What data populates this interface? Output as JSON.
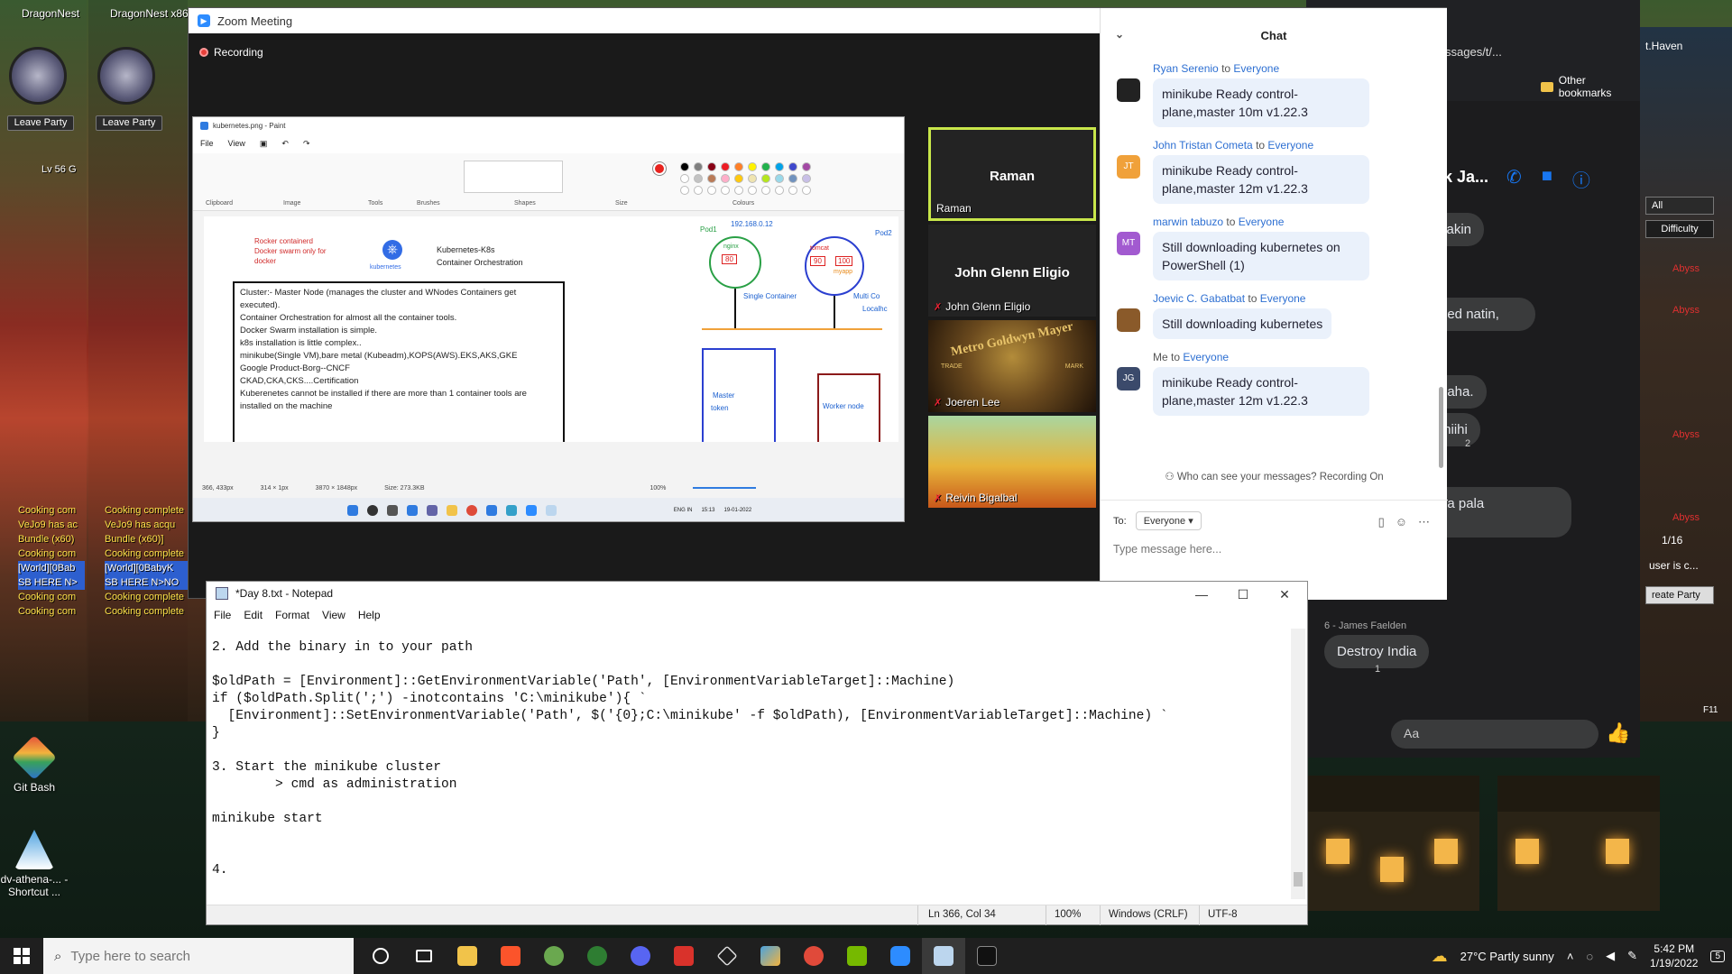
{
  "game": {
    "players": [
      {
        "name": "DragonNest",
        "leave": "Leave Party"
      },
      {
        "name": "DragonNest x86",
        "leave": "Leave Party"
      }
    ],
    "level": "Lv 56 G",
    "log_left": [
      "Cooking com",
      "VeJo9 has ac",
      "Bundle (x60)",
      "Cooking com",
      "[World][0Bab",
      "SB HERE N>",
      "Cooking com",
      "Cooking com"
    ],
    "log_right": [
      "Cooking complete",
      "VeJo9 has acqu",
      "Bundle (x60)]",
      "Cooking complete",
      "[World][0BabyK",
      "SB HERE N>NO",
      "Cooking complete",
      "Cooking complete"
    ],
    "right_panel": {
      "name": "t.Haven",
      "filter": "All",
      "difficulty": "Difficulty",
      "abyss": [
        "Abyss",
        "Abyss",
        "Abyss",
        "Abyss"
      ],
      "page": "1/16",
      "user": "user is c...",
      "create": "reate Party",
      "fkey": "F11"
    }
  },
  "desktop": {
    "icons": [
      {
        "label": "Git Bash"
      },
      {
        "label": "dv-athena-... - Shortcut ..."
      }
    ]
  },
  "messenger": {
    "url": "ssages/t/...",
    "bookmarks": "Other bookmarks",
    "contact": "k Ja...",
    "bubbles": [
      "sakin",
      "eed natin,",
      "haha.",
      "miihi",
      "na pala",
      "Destroy India"
    ],
    "reaction_count": "2",
    "reaction_count2": "1",
    "sender": "6 - James Faelden",
    "composer_placeholder": "Aa"
  },
  "zoom": {
    "title": "Zoom Meeting",
    "recording": "Recording",
    "paint": {
      "title": "kubernetes.png - Paint",
      "menu": [
        "File",
        "View"
      ],
      "groups": [
        "Clipboard",
        "Image",
        "Tools",
        "Brushes",
        "Shapes",
        "Size",
        "Colours"
      ],
      "red_note": [
        "Rocker containerd",
        "Docker swarm only for",
        "docker"
      ],
      "k8s_logo": "kubernetes",
      "heading1": "Kubernetes-K8s",
      "heading2": "Container Orchestration",
      "notes": [
        "Cluster:- Master Node (manages the cluster and WNodes Containers get executed).",
        "Container Orchestration for almost all the container tools.",
        "Docker Swarm installation is simple.",
        "k8s installation is little complex..",
        "minikube(Single VM),bare metal (Kubeadm),KOPS(AWS).EKS,AKS,GKE",
        "Google Product-Borg--CNCF",
        "CKAD,CKA,CKS....Certification",
        "Kuberenetes cannot be installed if there are more than 1 container tools are installed on the machine"
      ],
      "pod1": "Pod1",
      "ip": "192.168.0.12",
      "pod2": "Pod2",
      "nginx": "nginx",
      "port80": "80",
      "tomcat": "tomcat",
      "port90": "90",
      "port100": "100",
      "myapp": "myapp",
      "single": "Single Container",
      "multi": "Multi Co",
      "localhost": "Localhc",
      "master": "Master",
      "token": "token",
      "worker": "Worker node",
      "status": [
        "366, 433px",
        "314 × 1px",
        "3870 × 1848px",
        "Size: 273.3KB",
        "100%"
      ],
      "tray_time": "15:13",
      "tray_date": "19-01-2022",
      "tray_lang": "ENG IN"
    },
    "tiles": [
      {
        "name": "Raman",
        "center": "Raman"
      },
      {
        "name": "John Glenn Eligio",
        "center": "John Glenn Eligio"
      },
      {
        "name": "Joeren Lee",
        "logo_line1": "Metro Goldwyn Mayer",
        "logo_trade": "TRADE",
        "logo_mark": "MARK"
      },
      {
        "name": "Reivin Bigalbal"
      }
    ],
    "chat": {
      "title": "Chat",
      "messages": [
        {
          "from": "Ryan Serenio",
          "to": "Everyone",
          "text": "minikube   Ready   control-plane,master   10m   v1.22.3"
        },
        {
          "from": "John Tristan Cometa",
          "to": "Everyone",
          "initials": "JT",
          "text": "minikube   Ready   control-plane,master   12m   v1.22.3"
        },
        {
          "from": "marwin tabuzo",
          "to": "Everyone",
          "initials": "MT",
          "text": "Still downloading kubernetes on PowerShell (1)"
        },
        {
          "from": "Joevic C. Gabatbat",
          "to": "Everyone",
          "text": "Still downloading kubernetes"
        },
        {
          "from": "Me",
          "to": "Everyone",
          "initials": "JG",
          "text": "minikube   Ready   control-plane,master   12m   v1.22.3"
        }
      ],
      "to_word": "to",
      "visibility": "Who can see your messages? Recording On",
      "to_label": "To:",
      "recipient": "Everyone",
      "placeholder": "Type message here..."
    }
  },
  "notepad": {
    "title": "*Day 8.txt - Notepad",
    "menu": [
      "File",
      "Edit",
      "Format",
      "View",
      "Help"
    ],
    "lines": [
      "2. Add the binary in to your path",
      "",
      "$oldPath = [Environment]::GetEnvironmentVariable('Path', [EnvironmentVariableTarget]::Machine)",
      "if ($oldPath.Split(';') -inotcontains 'C:\\minikube'){ `",
      "  [Environment]::SetEnvironmentVariable('Path', $('{0};C:\\minikube' -f $oldPath), [EnvironmentVariableTarget]::Machine) `",
      "}",
      "",
      "3. Start the minikube cluster",
      "        > cmd as administration",
      "",
      "minikube start",
      "",
      "",
      "4."
    ],
    "status": {
      "position": "Ln 366, Col 34",
      "zoom": "100%",
      "eol": "Windows (CRLF)",
      "encoding": "UTF-8"
    }
  },
  "taskbar": {
    "search_placeholder": "Type here to search",
    "weather": "27°C  Partly sunny",
    "time": "5:42 PM",
    "date": "1/19/2022",
    "notif": "5"
  }
}
